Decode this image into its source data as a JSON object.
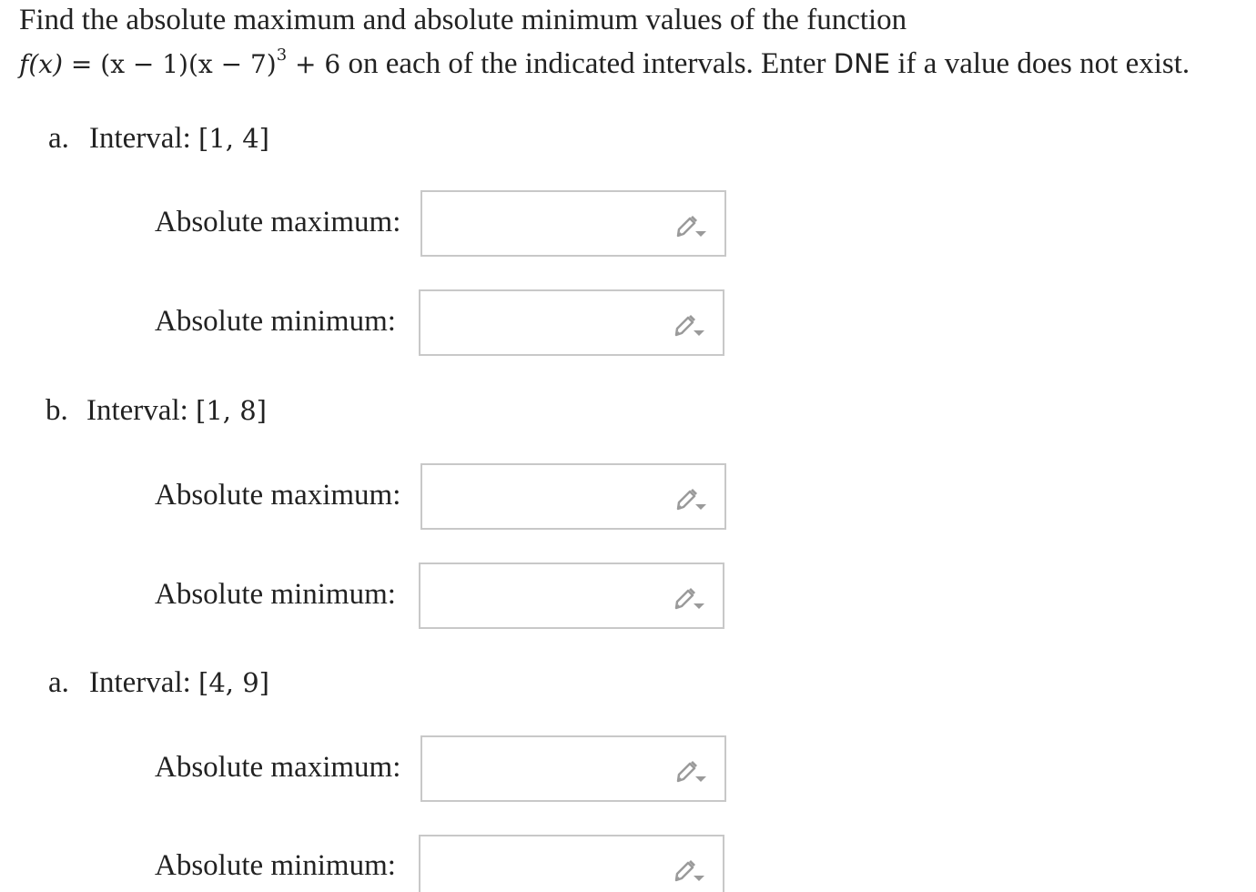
{
  "prompt": {
    "line1": "Find the absolute maximum and absolute minimum values of the function",
    "function_lhs": "f(x) = ",
    "function_rhs_a": "(x − 1)(x − 7)",
    "function_exponent": "3",
    "function_rhs_b": " + 6",
    "line2_text_a": " on each of the indicated intervals. Enter ",
    "dne_keyword": "DNE",
    "line2_text_b": " if a value does not exist."
  },
  "parts": [
    {
      "letter": "a.",
      "interval_label": "Interval:",
      "interval": "[1, 4]",
      "max_label": "Absolute maximum:",
      "max_value": "",
      "min_label": "Absolute minimum:",
      "min_value": ""
    },
    {
      "letter": "b.",
      "interval_label": "Interval:",
      "interval": "[1, 8]",
      "max_label": "Absolute maximum:",
      "max_value": "",
      "min_label": "Absolute minimum:",
      "min_value": ""
    },
    {
      "letter": "a.",
      "interval_label": "Interval:",
      "interval": "[4, 9]",
      "max_label": "Absolute maximum:",
      "max_value": "",
      "min_label": "Absolute minimum:",
      "min_value": ""
    }
  ],
  "icons": {
    "answer_box": "pencil-dropdown-icon"
  },
  "colors": {
    "text": "#222222",
    "box_border": "#c8c8c8",
    "icon": "#9a9a9a"
  }
}
